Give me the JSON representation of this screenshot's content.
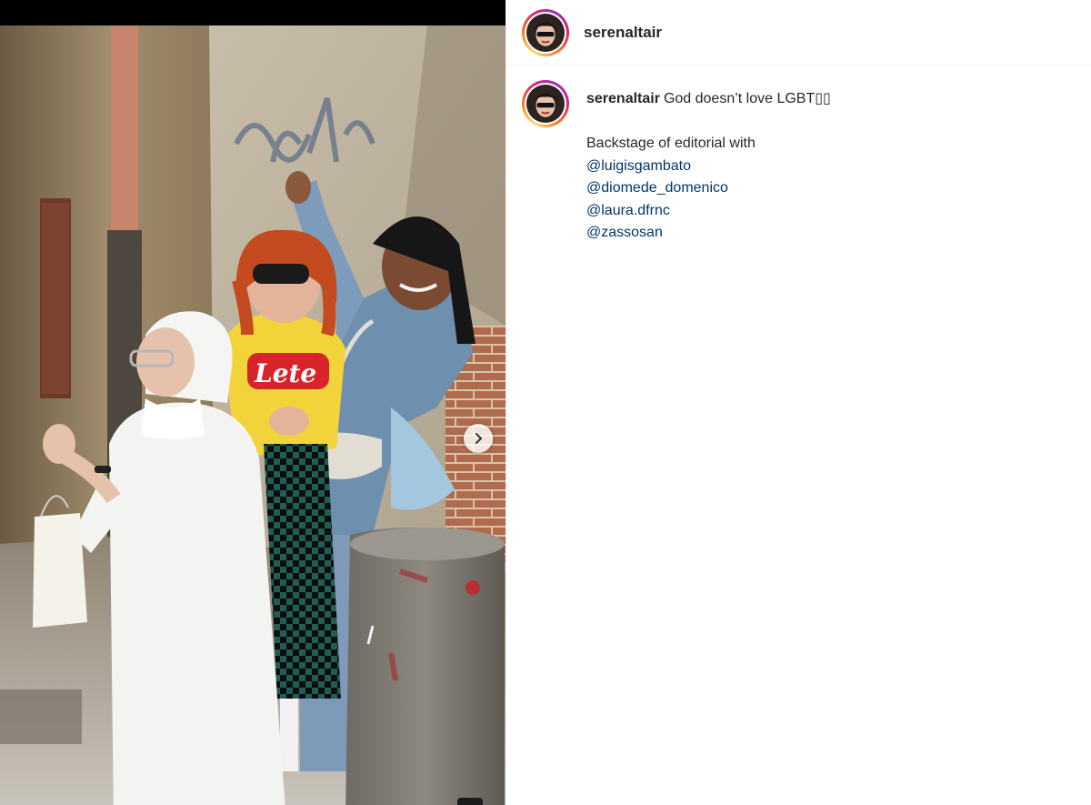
{
  "post": {
    "author": {
      "username": "serenaltair",
      "avatar_icon": "profile-avatar-icon"
    },
    "media": {
      "next_icon": "chevron-right-icon"
    },
    "caption": {
      "username": "serenaltair",
      "first_line": "God doesn’t love LGBT▯▯",
      "line_2": "Backstage of editorial with",
      "mentions": [
        "@luigisgambato",
        "@diomede_domenico",
        "@laura.dfrnc",
        "@zassosan"
      ]
    }
  },
  "colors": {
    "mention": "#00376b",
    "text": "#262626",
    "divider": "#efefef",
    "story_ring": [
      "#feda75",
      "#fa7e1e",
      "#d62976",
      "#962fbf"
    ]
  }
}
